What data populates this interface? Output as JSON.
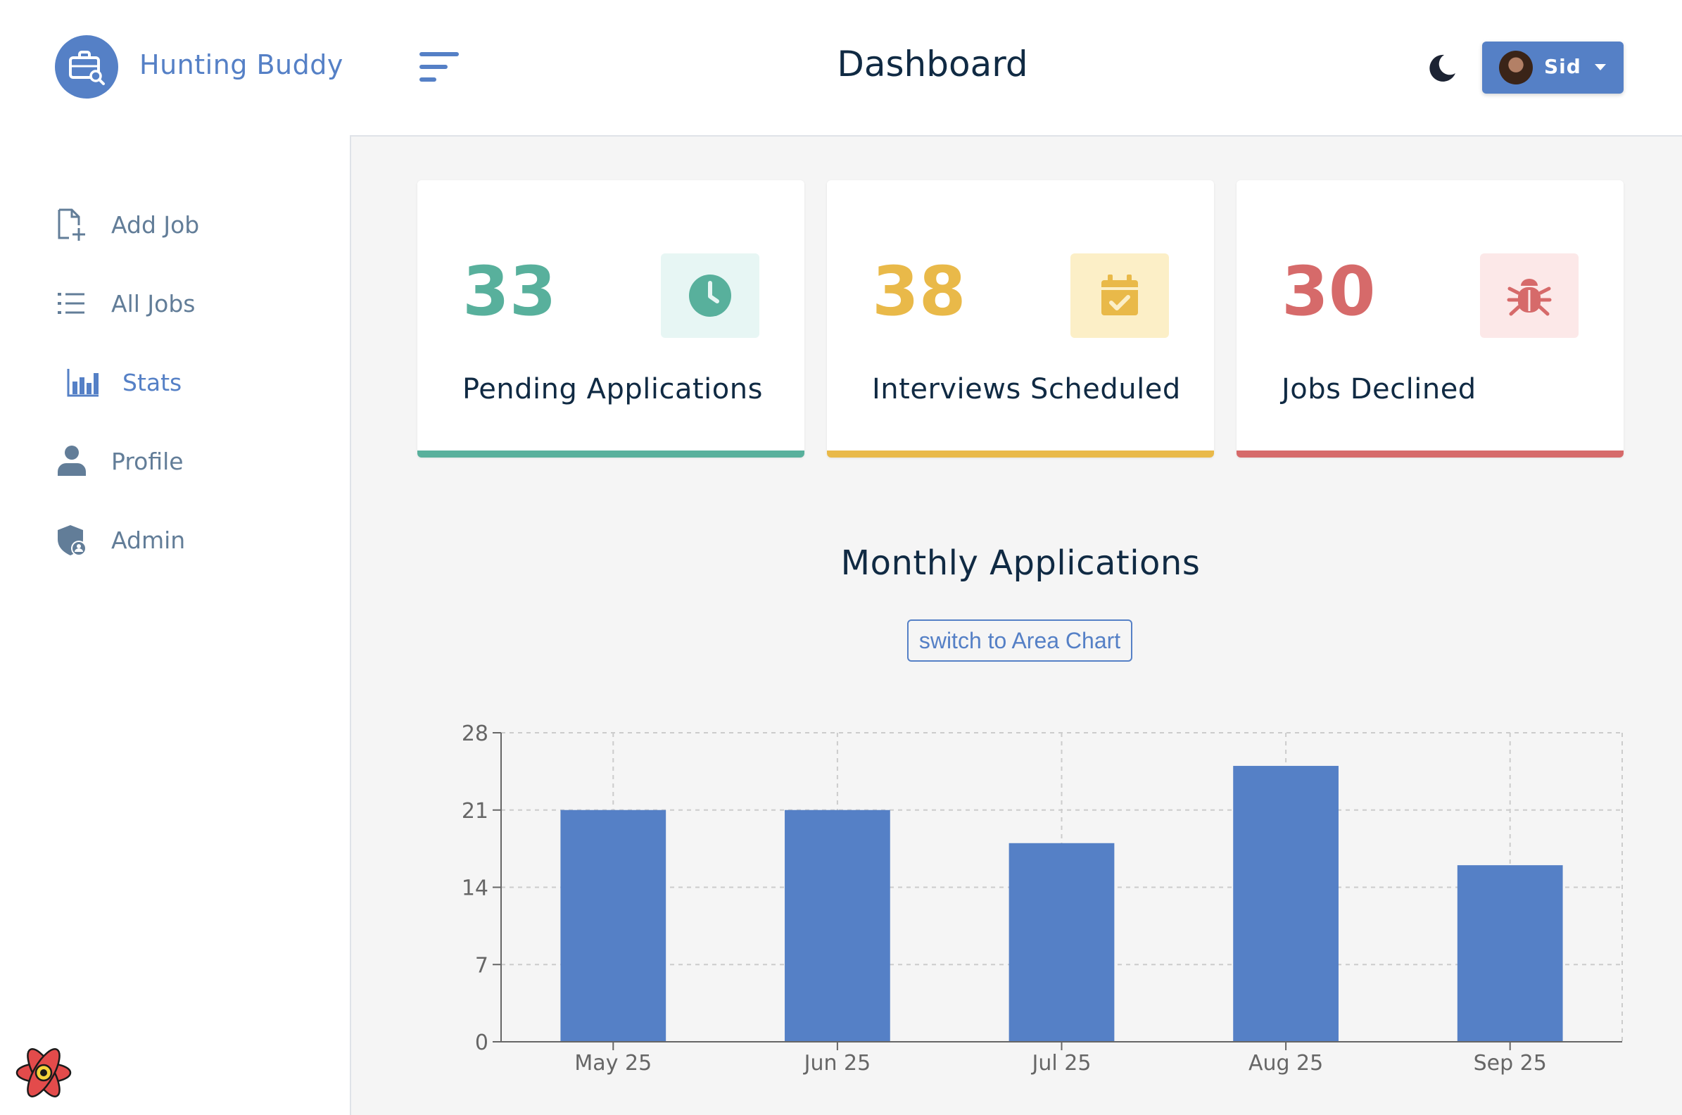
{
  "brand": {
    "name": "Hunting Buddy"
  },
  "header": {
    "title": "Dashboard",
    "user_name": "Sid"
  },
  "sidebar": {
    "items": [
      {
        "label": "Add Job",
        "icon": "add-file-icon"
      },
      {
        "label": "All Jobs",
        "icon": "list-icon"
      },
      {
        "label": "Stats",
        "icon": "bar-chart-icon",
        "active": true
      },
      {
        "label": "Profile",
        "icon": "user-icon"
      },
      {
        "label": "Admin",
        "icon": "admin-shield-icon"
      }
    ]
  },
  "stats": [
    {
      "count": "33",
      "label": "Pending Applications",
      "color": "#58b09c",
      "bg": "#e7f6f4",
      "icon": "clock-icon"
    },
    {
      "count": "38",
      "label": "Interviews Scheduled",
      "color": "#e9b949",
      "bg": "#fcefc7",
      "icon": "calendar-check-icon"
    },
    {
      "count": "30",
      "label": "Jobs Declined",
      "color": "#d66a6a",
      "bg": "#fce8e8",
      "icon": "bug-icon"
    }
  ],
  "chart_section": {
    "title": "Monthly Applications",
    "toggle_label": "switch to Area Chart"
  },
  "chart_data": {
    "type": "bar",
    "categories": [
      "May 25",
      "Jun 25",
      "Jul 25",
      "Aug 25",
      "Sep 25"
    ],
    "values": [
      21,
      21,
      18,
      25,
      16
    ],
    "ylim": [
      0,
      28
    ],
    "yticks": [
      0,
      7,
      14,
      21,
      28
    ],
    "grid": true,
    "bar_color": "#5580c6"
  }
}
